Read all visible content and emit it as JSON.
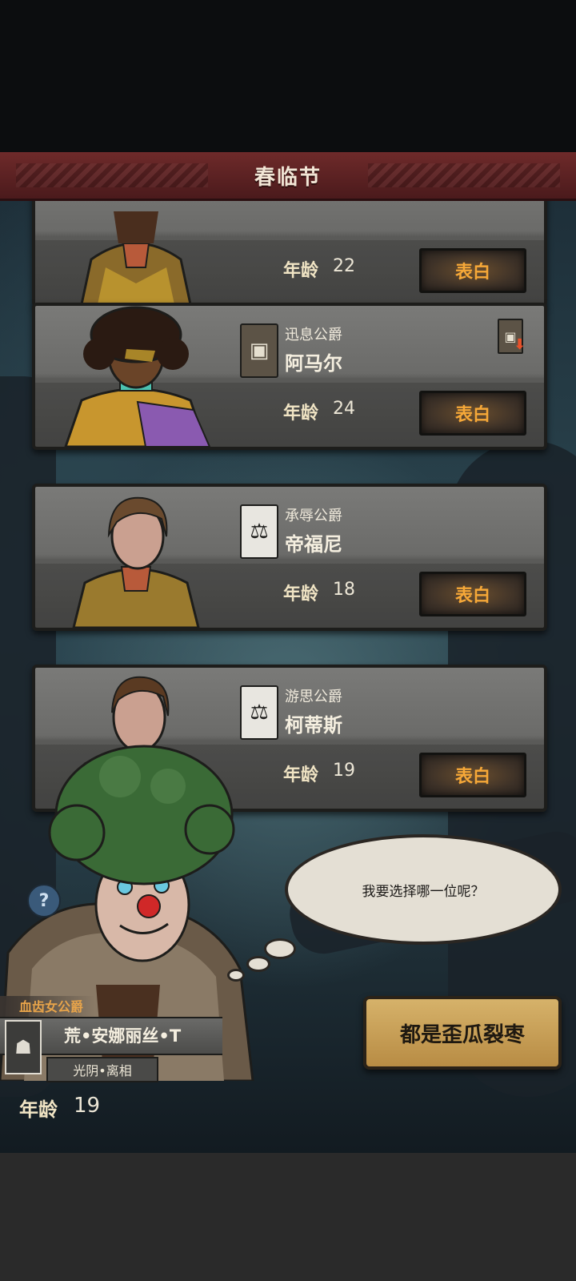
{
  "header": {
    "title": "春临节"
  },
  "candidates": [
    {
      "title": "",
      "name": "",
      "age_label": "年龄",
      "age": "22",
      "confess_label": "表白"
    },
    {
      "title": "迅息公爵",
      "name": "阿马尔",
      "age_label": "年龄",
      "age": "24",
      "confess_label": "表白"
    },
    {
      "title": "承辱公爵",
      "name": "帝福尼",
      "age_label": "年龄",
      "age": "18",
      "confess_label": "表白"
    },
    {
      "title": "游思公爵",
      "name": "柯蒂斯",
      "age_label": "年龄",
      "age": "19",
      "confess_label": "表白"
    }
  ],
  "speech": {
    "text": "我要选择哪一位呢？"
  },
  "player": {
    "title": "血齿女公爵",
    "name": "荒•安娜丽丝•T",
    "subtitle": "光阴•离相",
    "age_label": "年龄",
    "age": "19"
  },
  "actions": {
    "reject_label": "都是歪瓜裂枣"
  },
  "help": {
    "icon": "?"
  },
  "colors": {
    "header": "#6e2a2a",
    "confess_text": "#f6a838",
    "reject_bg": "#d6b26a"
  }
}
